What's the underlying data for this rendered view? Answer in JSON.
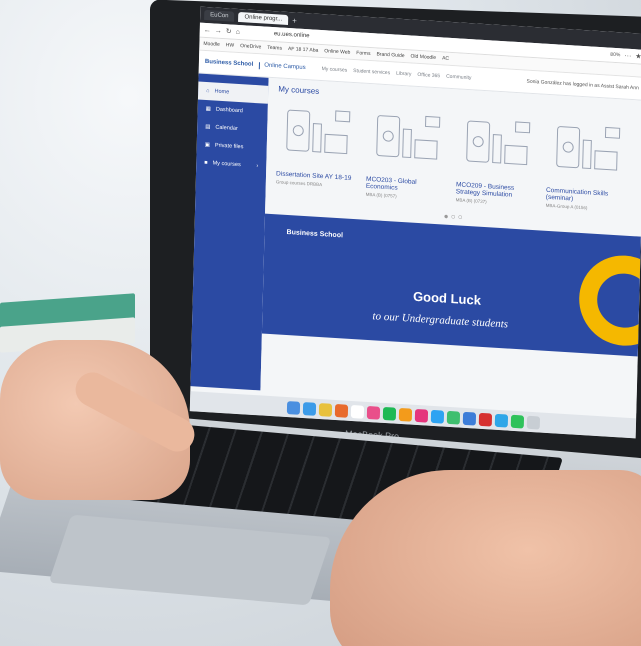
{
  "browser": {
    "tabs": [
      "EuCon",
      "Online progr..."
    ],
    "url": "eu.ues.online",
    "zoom": "80%",
    "bookmarks": [
      "Moodle",
      "HW",
      "OneDrive",
      "Teams",
      "AF 18 17 Aba",
      "Online Web",
      "Forms",
      "Brand Guide",
      "Old Moodle",
      "AC"
    ]
  },
  "site": {
    "logo": "Business School",
    "campus": "Online Campus",
    "menu": [
      "My courses",
      "Student services",
      "Library",
      "Office 365",
      "Community"
    ],
    "login_text": "Sonia González has logged in as Assist Sarah Ann",
    "sidebar": [
      "Home",
      "Dashboard",
      "Calendar",
      "Private files",
      "My courses"
    ],
    "section_title": "My courses",
    "courses": [
      {
        "name": "Dissertation Site AY 18-19",
        "sub": "Group courses DRBBA"
      },
      {
        "name": "MCO203 - Global Economics",
        "sub": "MBA (B) (0757)"
      },
      {
        "name": "MCO209 - Business Strategy Simulation",
        "sub": "MBA (B) (0737)"
      },
      {
        "name": "Communication Skills (seminar)",
        "sub": "MBA-Group A (0156)"
      }
    ],
    "banner": {
      "logo": "Business School",
      "line1": "Good Luck",
      "line2": "to our Undergraduate students"
    }
  },
  "laptop_label": "MacBook Pro",
  "colors": {
    "brand_blue": "#2b4aa3",
    "accent_yellow": "#f5b800"
  }
}
